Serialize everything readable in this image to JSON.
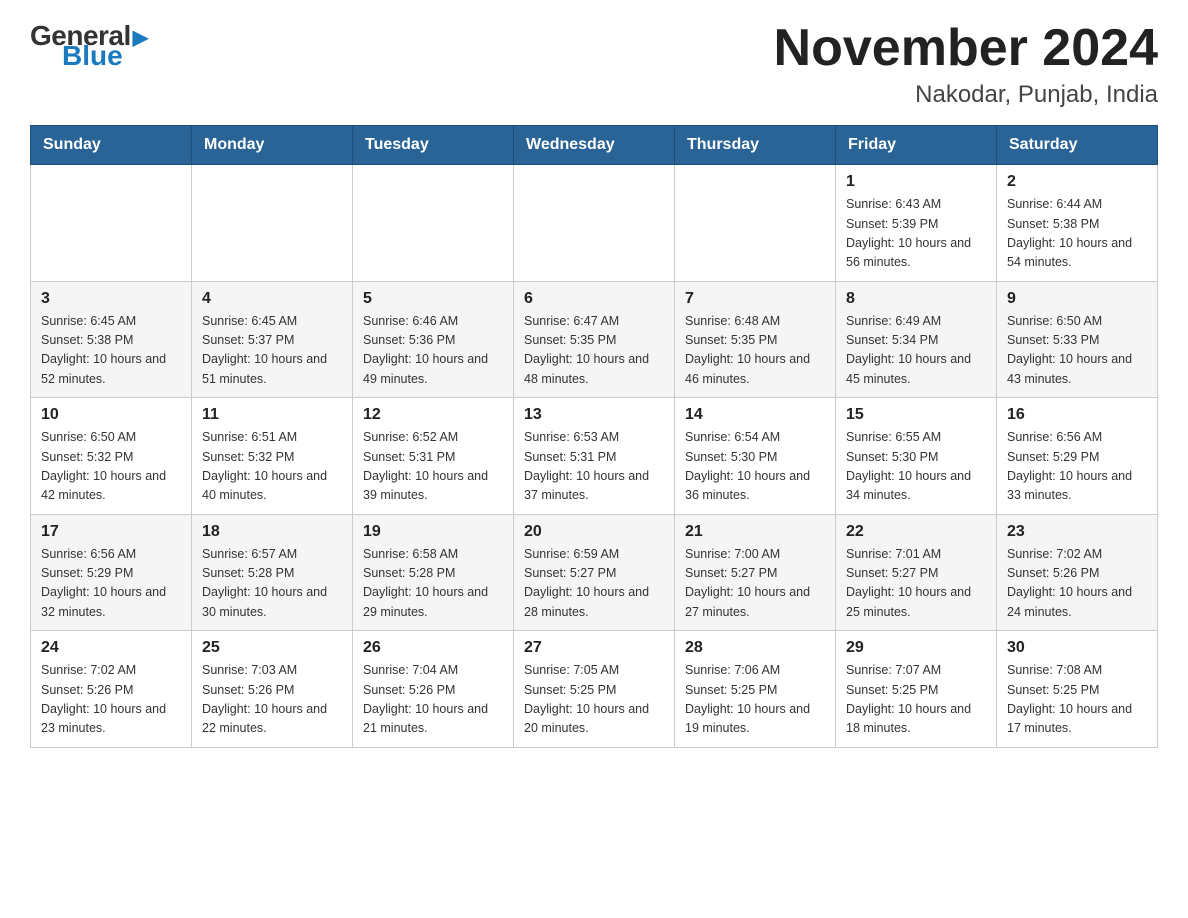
{
  "logo": {
    "general": "General",
    "blue": "Blue",
    "triangle_char": "▲"
  },
  "title": "November 2024",
  "subtitle": "Nakodar, Punjab, India",
  "weekdays": [
    "Sunday",
    "Monday",
    "Tuesday",
    "Wednesday",
    "Thursday",
    "Friday",
    "Saturday"
  ],
  "weeks": [
    [
      {
        "day": "",
        "info": ""
      },
      {
        "day": "",
        "info": ""
      },
      {
        "day": "",
        "info": ""
      },
      {
        "day": "",
        "info": ""
      },
      {
        "day": "",
        "info": ""
      },
      {
        "day": "1",
        "info": "Sunrise: 6:43 AM\nSunset: 5:39 PM\nDaylight: 10 hours and 56 minutes."
      },
      {
        "day": "2",
        "info": "Sunrise: 6:44 AM\nSunset: 5:38 PM\nDaylight: 10 hours and 54 minutes."
      }
    ],
    [
      {
        "day": "3",
        "info": "Sunrise: 6:45 AM\nSunset: 5:38 PM\nDaylight: 10 hours and 52 minutes."
      },
      {
        "day": "4",
        "info": "Sunrise: 6:45 AM\nSunset: 5:37 PM\nDaylight: 10 hours and 51 minutes."
      },
      {
        "day": "5",
        "info": "Sunrise: 6:46 AM\nSunset: 5:36 PM\nDaylight: 10 hours and 49 minutes."
      },
      {
        "day": "6",
        "info": "Sunrise: 6:47 AM\nSunset: 5:35 PM\nDaylight: 10 hours and 48 minutes."
      },
      {
        "day": "7",
        "info": "Sunrise: 6:48 AM\nSunset: 5:35 PM\nDaylight: 10 hours and 46 minutes."
      },
      {
        "day": "8",
        "info": "Sunrise: 6:49 AM\nSunset: 5:34 PM\nDaylight: 10 hours and 45 minutes."
      },
      {
        "day": "9",
        "info": "Sunrise: 6:50 AM\nSunset: 5:33 PM\nDaylight: 10 hours and 43 minutes."
      }
    ],
    [
      {
        "day": "10",
        "info": "Sunrise: 6:50 AM\nSunset: 5:32 PM\nDaylight: 10 hours and 42 minutes."
      },
      {
        "day": "11",
        "info": "Sunrise: 6:51 AM\nSunset: 5:32 PM\nDaylight: 10 hours and 40 minutes."
      },
      {
        "day": "12",
        "info": "Sunrise: 6:52 AM\nSunset: 5:31 PM\nDaylight: 10 hours and 39 minutes."
      },
      {
        "day": "13",
        "info": "Sunrise: 6:53 AM\nSunset: 5:31 PM\nDaylight: 10 hours and 37 minutes."
      },
      {
        "day": "14",
        "info": "Sunrise: 6:54 AM\nSunset: 5:30 PM\nDaylight: 10 hours and 36 minutes."
      },
      {
        "day": "15",
        "info": "Sunrise: 6:55 AM\nSunset: 5:30 PM\nDaylight: 10 hours and 34 minutes."
      },
      {
        "day": "16",
        "info": "Sunrise: 6:56 AM\nSunset: 5:29 PM\nDaylight: 10 hours and 33 minutes."
      }
    ],
    [
      {
        "day": "17",
        "info": "Sunrise: 6:56 AM\nSunset: 5:29 PM\nDaylight: 10 hours and 32 minutes."
      },
      {
        "day": "18",
        "info": "Sunrise: 6:57 AM\nSunset: 5:28 PM\nDaylight: 10 hours and 30 minutes."
      },
      {
        "day": "19",
        "info": "Sunrise: 6:58 AM\nSunset: 5:28 PM\nDaylight: 10 hours and 29 minutes."
      },
      {
        "day": "20",
        "info": "Sunrise: 6:59 AM\nSunset: 5:27 PM\nDaylight: 10 hours and 28 minutes."
      },
      {
        "day": "21",
        "info": "Sunrise: 7:00 AM\nSunset: 5:27 PM\nDaylight: 10 hours and 27 minutes."
      },
      {
        "day": "22",
        "info": "Sunrise: 7:01 AM\nSunset: 5:27 PM\nDaylight: 10 hours and 25 minutes."
      },
      {
        "day": "23",
        "info": "Sunrise: 7:02 AM\nSunset: 5:26 PM\nDaylight: 10 hours and 24 minutes."
      }
    ],
    [
      {
        "day": "24",
        "info": "Sunrise: 7:02 AM\nSunset: 5:26 PM\nDaylight: 10 hours and 23 minutes."
      },
      {
        "day": "25",
        "info": "Sunrise: 7:03 AM\nSunset: 5:26 PM\nDaylight: 10 hours and 22 minutes."
      },
      {
        "day": "26",
        "info": "Sunrise: 7:04 AM\nSunset: 5:26 PM\nDaylight: 10 hours and 21 minutes."
      },
      {
        "day": "27",
        "info": "Sunrise: 7:05 AM\nSunset: 5:25 PM\nDaylight: 10 hours and 20 minutes."
      },
      {
        "day": "28",
        "info": "Sunrise: 7:06 AM\nSunset: 5:25 PM\nDaylight: 10 hours and 19 minutes."
      },
      {
        "day": "29",
        "info": "Sunrise: 7:07 AM\nSunset: 5:25 PM\nDaylight: 10 hours and 18 minutes."
      },
      {
        "day": "30",
        "info": "Sunrise: 7:08 AM\nSunset: 5:25 PM\nDaylight: 10 hours and 17 minutes."
      }
    ]
  ]
}
